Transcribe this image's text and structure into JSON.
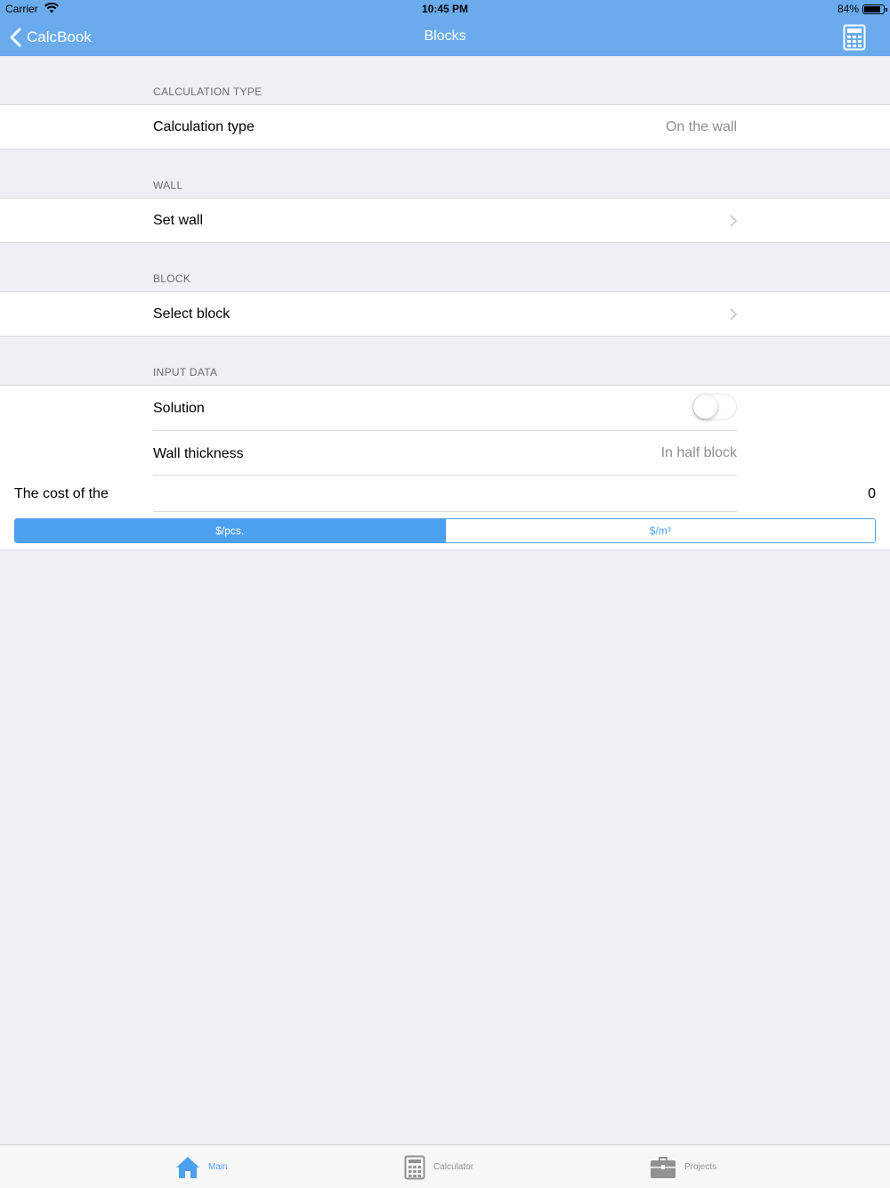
{
  "status_bar": {
    "carrier": "Carrier",
    "time": "10:45 PM",
    "battery": "84%"
  },
  "nav": {
    "back_label": "CalcBook",
    "title": "Blocks",
    "right_icon": "calculator-icon"
  },
  "sections": {
    "calculation_type": {
      "header": "CALCULATION TYPE",
      "label": "Calculation type",
      "value": "On the wall"
    },
    "wall": {
      "header": "WALL",
      "label": "Set wall"
    },
    "block": {
      "header": "BLOCK",
      "label": "Select block"
    },
    "input_data": {
      "header": "INPUT DATA",
      "solution_label": "Solution",
      "solution_on": false,
      "wall_thickness_label": "Wall thickness",
      "wall_thickness_value": "In half block",
      "cost_label": "The cost of the",
      "cost_value": "0",
      "units": [
        "$/pcs.",
        "$/m³"
      ],
      "selected_unit": "$/pcs."
    }
  },
  "tabs": [
    {
      "label": "Main",
      "icon": "home-icon",
      "active": true
    },
    {
      "label": "Calculator",
      "icon": "calculator-icon",
      "active": false
    },
    {
      "label": "Projects",
      "icon": "briefcase-icon",
      "active": false
    }
  ],
  "colors": {
    "nav_background": "#6aabed",
    "accent": "#4d9ff0",
    "page_background": "#efeff4"
  }
}
